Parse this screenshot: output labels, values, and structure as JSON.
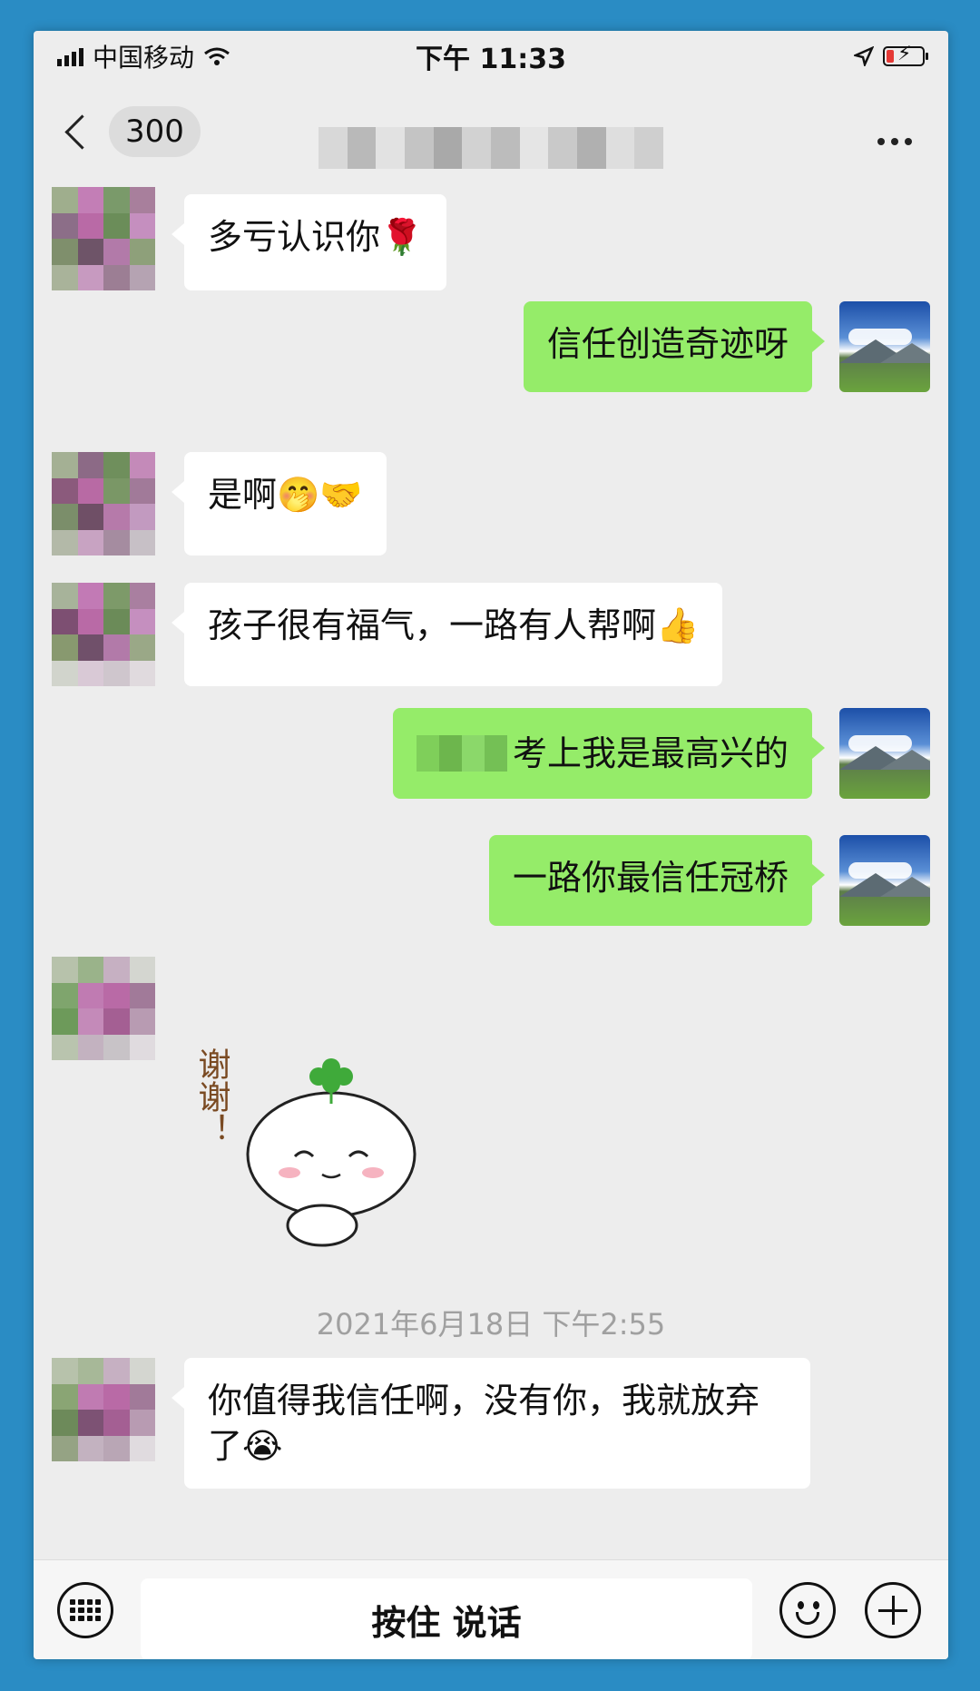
{
  "status_bar": {
    "carrier": "中国移动",
    "time": "下午 11:33"
  },
  "nav": {
    "unread_count": "300"
  },
  "messages": [
    {
      "side": "left",
      "text": "多亏认识你🌹"
    },
    {
      "side": "right",
      "text": "信任创造奇迹呀"
    },
    {
      "side": "left",
      "text": "是啊🤭🤝"
    },
    {
      "side": "left",
      "text": "孩子很有福气，一路有人帮啊👍"
    },
    {
      "side": "right",
      "text": "考上我是最高兴的"
    },
    {
      "side": "right",
      "text": "一路你最信任冠桥"
    },
    {
      "side": "left",
      "sticker_text": "谢谢！"
    },
    {
      "side": "left",
      "text": "你值得我信任啊，没有你，我就放弃了😭"
    }
  ],
  "timestamp": "2021年6月18日 下午2:55",
  "input_bar": {
    "voice_label": "按住 说话"
  },
  "colors": {
    "my_bubble": "#95ec69",
    "their_bubble": "#ffffff",
    "chat_background": "#ededed",
    "frame": "#2a8cc4"
  }
}
